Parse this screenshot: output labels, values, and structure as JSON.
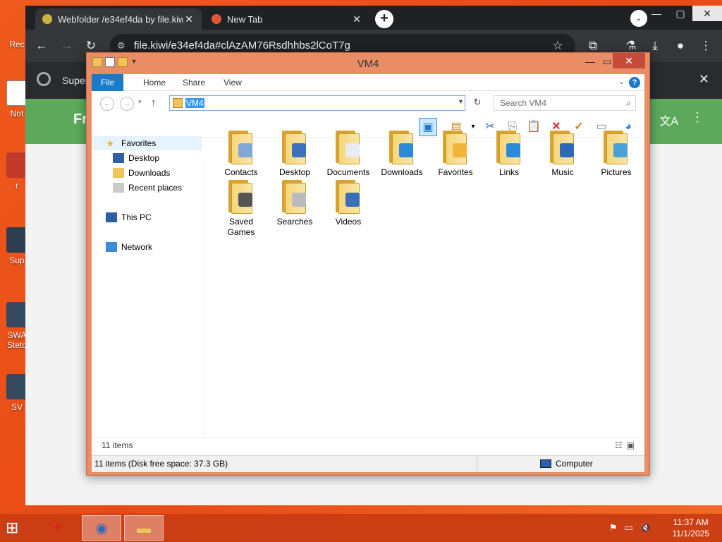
{
  "desktop_icons": [
    {
      "label": "Rec",
      "icon": "recycle-bin-icon"
    },
    {
      "label": "Not",
      "icon": "notepad-icon"
    },
    {
      "label": "r",
      "icon": "shortcut-icon"
    },
    {
      "label": "Sup",
      "icon": "shortcut-icon"
    },
    {
      "label": "SWA Steto",
      "icon": "shortcut-icon"
    },
    {
      "label": "SV",
      "icon": "shortcut-icon"
    }
  ],
  "browser": {
    "tabs": [
      {
        "title": "Webfolder /e34ef4da by file.kiwi",
        "active": true
      },
      {
        "title": "New Tab",
        "active": false
      }
    ],
    "url": "file.kiwi/e34ef4da#clAzAM76Rsdhhbs2lCoT7g",
    "infobar_text": "Super",
    "page_green_text": "Fr"
  },
  "explorer": {
    "title": "VM4",
    "ribbon_tabs": [
      "File",
      "Home",
      "Share",
      "View"
    ],
    "address": "VM4",
    "search_placeholder": "Search VM4",
    "nav": {
      "favorites": "Favorites",
      "desktop": "Desktop",
      "downloads": "Downloads",
      "recent": "Recent places",
      "this_pc": "This PC",
      "network": "Network"
    },
    "items": [
      {
        "label": "Contacts",
        "icon": "contacts-folder-icon"
      },
      {
        "label": "Desktop",
        "icon": "desktop-folder-icon"
      },
      {
        "label": "Documents",
        "icon": "documents-folder-icon"
      },
      {
        "label": "Downloads",
        "icon": "downloads-folder-icon"
      },
      {
        "label": "Favorites",
        "icon": "favorites-folder-icon"
      },
      {
        "label": "Links",
        "icon": "links-folder-icon"
      },
      {
        "label": "Music",
        "icon": "music-folder-icon"
      },
      {
        "label": "Pictures",
        "icon": "pictures-folder-icon"
      },
      {
        "label": "Saved Games",
        "icon": "saved-games-folder-icon"
      },
      {
        "label": "Searches",
        "icon": "searches-folder-icon"
      },
      {
        "label": "Videos",
        "icon": "videos-folder-icon"
      }
    ],
    "item_count": "11 items",
    "status_left": "11 items (Disk free space: 37.3 GB)",
    "status_right": "Computer"
  },
  "taskbar": {
    "time": "11:37 AM",
    "date": "11/1/2025"
  },
  "colors": {
    "desktop": "#f05a1e",
    "explorer_frame": "#e98d67",
    "ribbon_file": "#1979ca",
    "green_bar": "#5ca95c"
  }
}
